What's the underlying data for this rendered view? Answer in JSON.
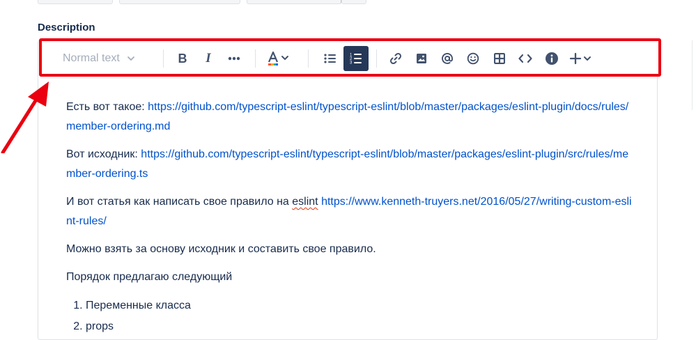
{
  "field": {
    "label": "Description"
  },
  "toolbar": {
    "text_style": "Normal text",
    "buttons": [
      {
        "name": "bold",
        "icon": "bold-icon",
        "glyph": "B"
      },
      {
        "name": "italic",
        "icon": "italic-icon",
        "glyph": "I"
      },
      {
        "name": "more-formatting",
        "icon": "more-icon"
      },
      {
        "name": "text-color",
        "icon": "text-color-icon"
      },
      {
        "name": "bullet-list",
        "icon": "bullet-list-icon"
      },
      {
        "name": "numbered-list",
        "icon": "numbered-list-icon",
        "active": true
      },
      {
        "name": "link",
        "icon": "link-icon"
      },
      {
        "name": "image",
        "icon": "image-icon"
      },
      {
        "name": "mention",
        "icon": "mention-icon"
      },
      {
        "name": "emoji",
        "icon": "emoji-icon"
      },
      {
        "name": "table",
        "icon": "table-icon"
      },
      {
        "name": "code",
        "icon": "code-icon"
      },
      {
        "name": "info",
        "icon": "info-icon"
      },
      {
        "name": "insert",
        "icon": "plus-icon"
      }
    ],
    "highlight_color": "#ea0010",
    "active_color": "#253858"
  },
  "content": {
    "p1_text": "Есть вот такое: ",
    "p1_link": "https://github.com/typescript-eslint/typescript-eslint/blob/master/packages/eslint-plugin/docs/rules/member-ordering.md",
    "p2_text": "Вот исходник: ",
    "p2_link": "https://github.com/typescript-eslint/typescript-eslint/blob/master/packages/eslint-plugin/src/rules/member-ordering.ts",
    "p3_text_a": "И вот статья как написать свое правило на ",
    "p3_text_b": "eslint",
    "p3_link": "https://www.kenneth-truyers.net/2016/05/27/writing-custom-eslint-rules/",
    "p4_text": "Можно взять за основу исходник и составить свое правило.",
    "p5_text": "Порядок предлагаю следующий",
    "list": [
      "Переменные класса",
      "props"
    ]
  },
  "colors": {
    "link": "#0052cc",
    "text": "#172b4d",
    "annotation_arrow": "#ea0010"
  }
}
